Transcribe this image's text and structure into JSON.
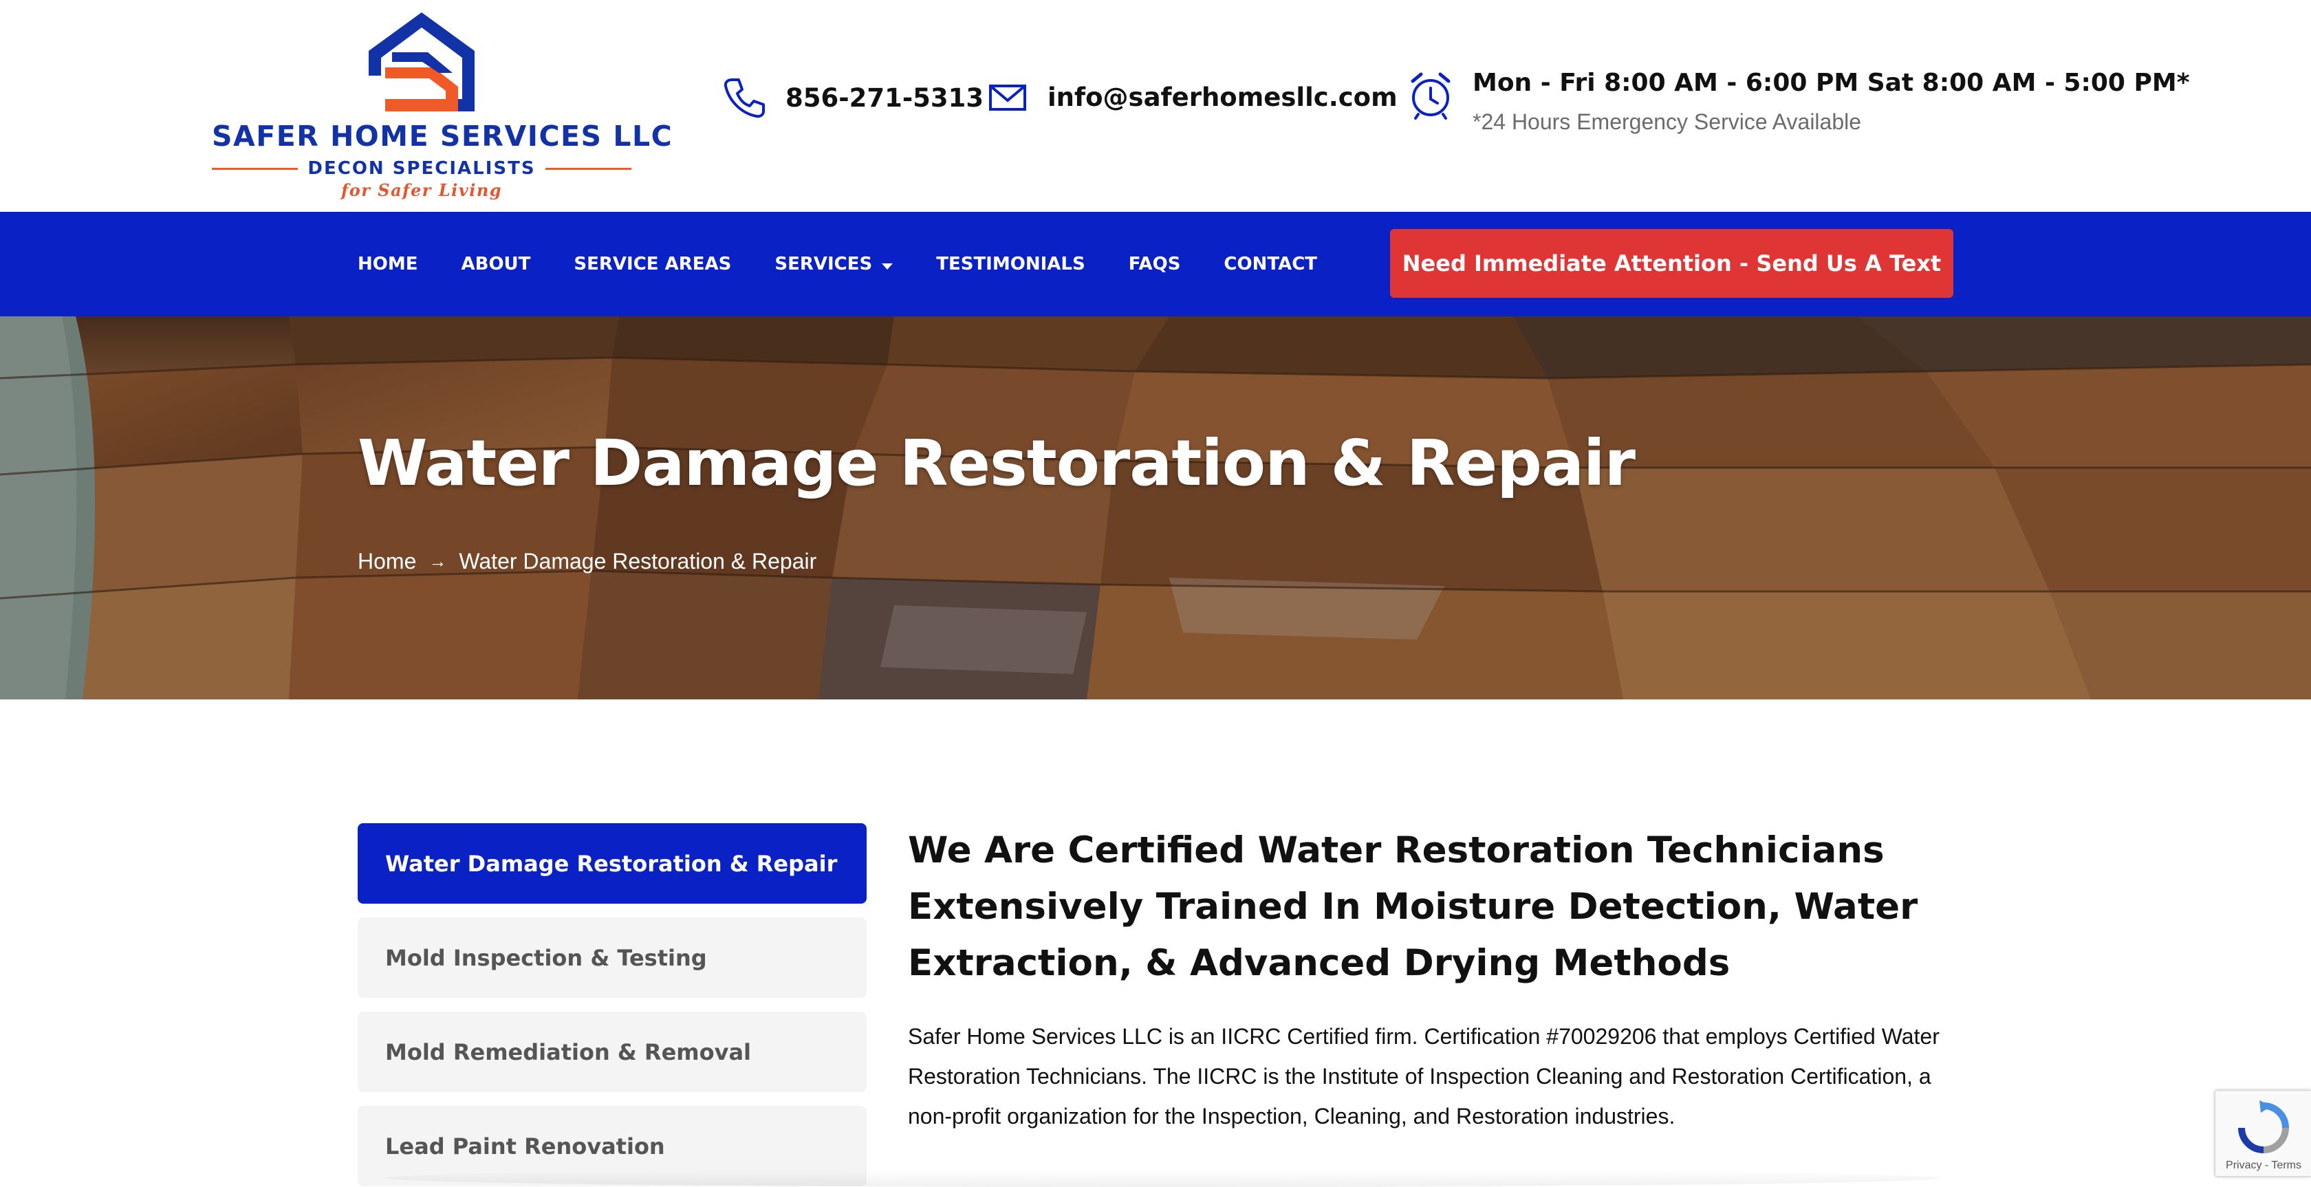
{
  "header": {
    "logo": {
      "name": "SAFER HOME SERVICES LLC",
      "subtitle": "DECON SPECIALISTS",
      "tagline": "for Safer Living"
    },
    "phone": "856-271-5313",
    "email": "info@saferhomesllc.com",
    "hours": "Mon - Fri 8:00 AM - 6:00 PM Sat 8:00 AM - 5:00 PM*",
    "hours_note": "*24 Hours Emergency Service Available"
  },
  "nav": {
    "items": [
      {
        "label": "HOME"
      },
      {
        "label": "ABOUT"
      },
      {
        "label": "SERVICE AREAS"
      },
      {
        "label": "SERVICES"
      },
      {
        "label": "TESTIMONIALS"
      },
      {
        "label": "FAQS"
      },
      {
        "label": "CONTACT"
      }
    ],
    "cta": "Need Immediate Attention - Send Us A Text"
  },
  "hero": {
    "title": "Water Damage Restoration & Repair",
    "breadcrumb": {
      "home": "Home",
      "separator": "→",
      "current": "Water Damage Restoration & Repair"
    }
  },
  "sidebar": {
    "items": [
      {
        "label": "Water Damage Restoration & Repair"
      },
      {
        "label": "Mold Inspection & Testing"
      },
      {
        "label": "Mold Remediation & Removal"
      },
      {
        "label": "Lead Paint Renovation"
      }
    ]
  },
  "main": {
    "heading": "We Are Certified Water Restoration Technicians Extensively Trained In Moisture Detection, Water Extraction, & Advanced Drying Methods",
    "paragraph": "Safer Home Services LLC is an IICRC Certified firm. Certification #70029206 that employs Certified Water Restoration Technicians. The IICRC is the Institute of Inspection Cleaning and Restoration Certification, a non-profit organization for the Inspection, Cleaning, and Restoration industries."
  },
  "recaptcha": {
    "links": "Privacy - Terms"
  },
  "colors": {
    "brand_blue": "#0a21c6",
    "cta_red": "#e03535",
    "logo_orange": "#f05a28",
    "logo_blue": "#1233a8"
  }
}
